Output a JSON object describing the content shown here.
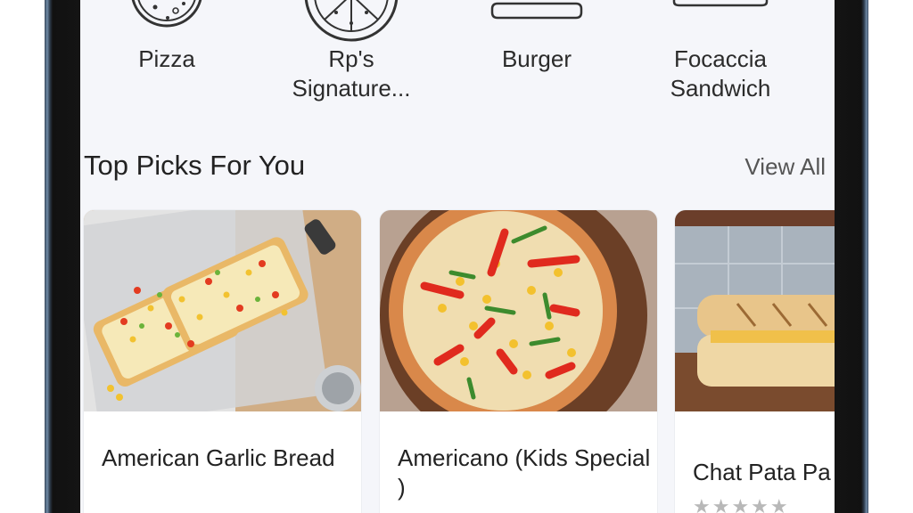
{
  "categories": [
    {
      "label": "Pizza",
      "icon": "pizza-icon"
    },
    {
      "label": "Rp's Signature...",
      "icon": "pizza-slices-icon"
    },
    {
      "label": "Burger",
      "icon": "burger-icon"
    },
    {
      "label": "Focaccia Sandwich",
      "icon": "sandwich-icon"
    }
  ],
  "section": {
    "title": "Top Picks For You",
    "view_all": "View All"
  },
  "products": [
    {
      "name": "American Garlic Bread",
      "image": "garlic-bread-image"
    },
    {
      "name": "Americano (Kids Special )",
      "image": "pizza-image"
    },
    {
      "name": "Chat Pata Pa",
      "image": "sandwich-image",
      "rating_stars": "★★★★★"
    }
  ]
}
